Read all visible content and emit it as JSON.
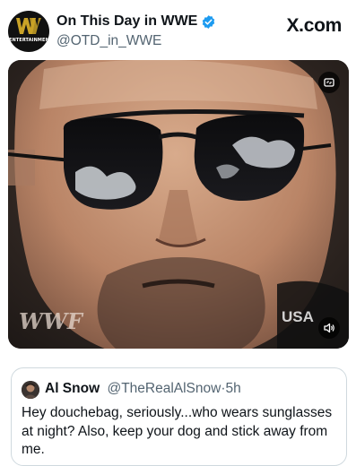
{
  "post": {
    "author_name": "On This Day in WWE",
    "author_handle": "@OTD_in_WWE",
    "avatar_text": "ENTERTAINMENT",
    "site_label": "X.com"
  },
  "media": {
    "watermark_left": "WWF",
    "watermark_right": "USA"
  },
  "quote": {
    "author_name": "Al Snow",
    "author_handle": "@TheRealAlSnow",
    "separator": "·",
    "time": "5h",
    "text": "Hey douchebag, seriously...who wears sunglasses at night? Also, keep your dog and stick away from me."
  },
  "colors": {
    "verified": "#1d9bf0",
    "secondary_text": "#536471",
    "border": "#cfd9de"
  }
}
